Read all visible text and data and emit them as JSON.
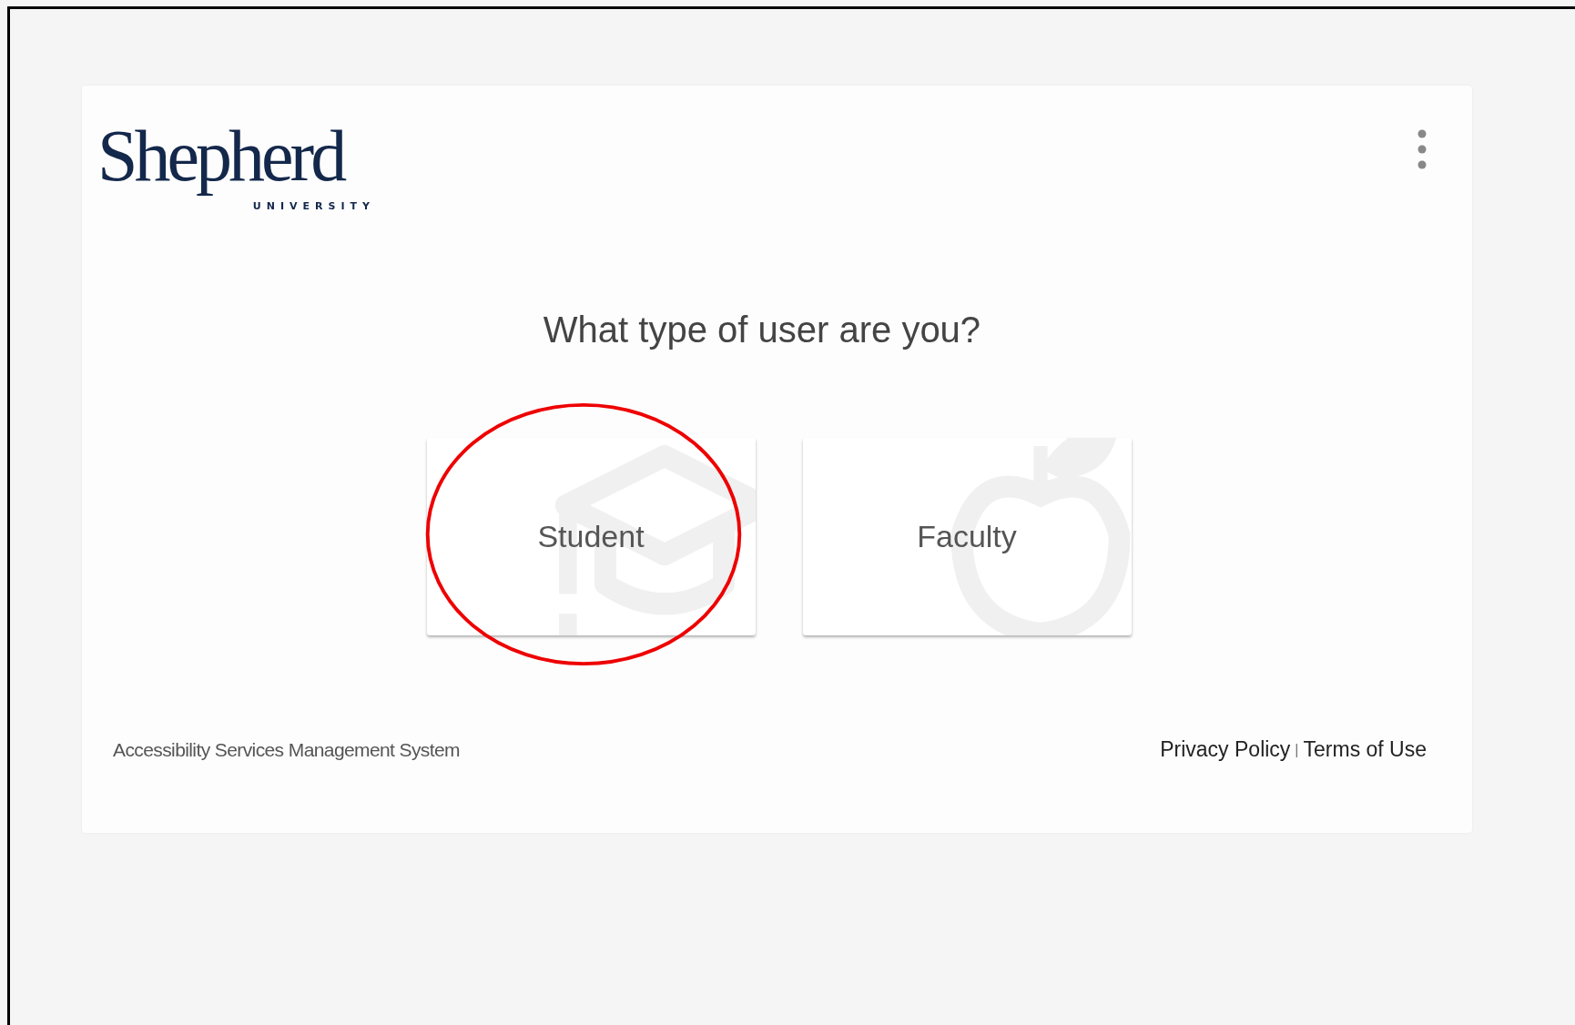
{
  "logo": {
    "name": "Shepherd",
    "subtitle": "UNIVERSITY"
  },
  "question": "What type of user are you?",
  "user_types": [
    {
      "label": "Student",
      "kind": "student",
      "circled": true
    },
    {
      "label": "Faculty",
      "kind": "faculty",
      "circled": false
    }
  ],
  "footer": {
    "system_name": "Accessibility Services Management System",
    "links": [
      "Privacy Policy",
      "Terms of Use"
    ],
    "separator": "|"
  }
}
